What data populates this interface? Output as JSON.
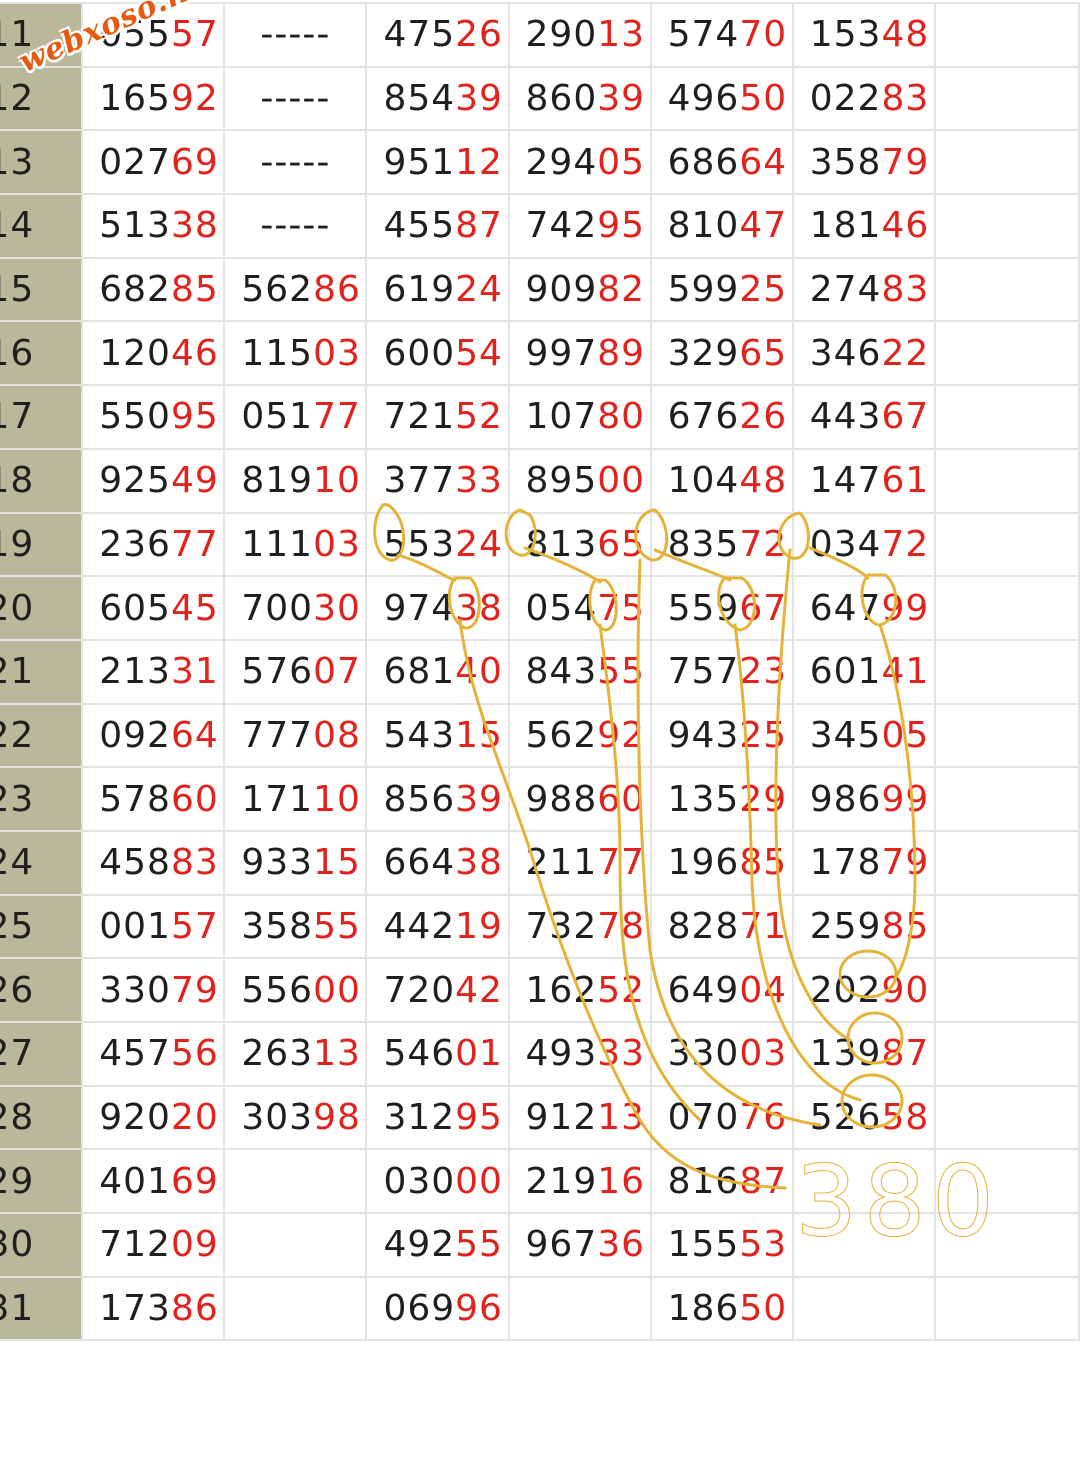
{
  "watermark": "webxoso.net",
  "annotation": "380",
  "colors": {
    "day_column_bg": "#b9b89a",
    "head_digits": "#1f1f1f",
    "tail_digits": "#e0231c",
    "annotation": "#e4b339",
    "watermark": "#e85a10"
  },
  "rows": [
    {
      "day": "11",
      "cells": [
        {
          "h": "055",
          "t": "57"
        },
        {
          "dash": "-----"
        },
        {
          "h": "475",
          "t": "26"
        },
        {
          "h": "290",
          "t": "13"
        },
        {
          "h": "574",
          "t": "70"
        },
        {
          "h": "153",
          "t": "48"
        }
      ]
    },
    {
      "day": "12",
      "cells": [
        {
          "h": "165",
          "t": "92"
        },
        {
          "dash": "-----"
        },
        {
          "h": "854",
          "t": "39"
        },
        {
          "h": "860",
          "t": "39"
        },
        {
          "h": "496",
          "t": "50"
        },
        {
          "h": "022",
          "t": "83"
        }
      ]
    },
    {
      "day": "13",
      "cells": [
        {
          "h": "027",
          "t": "69"
        },
        {
          "dash": "-----"
        },
        {
          "h": "951",
          "t": "12"
        },
        {
          "h": "294",
          "t": "05"
        },
        {
          "h": "686",
          "t": "64"
        },
        {
          "h": "358",
          "t": "79"
        }
      ]
    },
    {
      "day": "14",
      "cells": [
        {
          "h": "513",
          "t": "38"
        },
        {
          "dash": "-----"
        },
        {
          "h": "455",
          "t": "87"
        },
        {
          "h": "742",
          "t": "95"
        },
        {
          "h": "810",
          "t": "47"
        },
        {
          "h": "181",
          "t": "46"
        }
      ]
    },
    {
      "day": "15",
      "cells": [
        {
          "h": "682",
          "t": "85"
        },
        {
          "h": "562",
          "t": "86"
        },
        {
          "h": "619",
          "t": "24"
        },
        {
          "h": "909",
          "t": "82"
        },
        {
          "h": "599",
          "t": "25"
        },
        {
          "h": "274",
          "t": "83"
        }
      ]
    },
    {
      "day": "16",
      "cells": [
        {
          "h": "120",
          "t": "46"
        },
        {
          "h": "115",
          "t": "03"
        },
        {
          "h": "600",
          "t": "54"
        },
        {
          "h": "997",
          "t": "89"
        },
        {
          "h": "329",
          "t": "65"
        },
        {
          "h": "346",
          "t": "22"
        }
      ]
    },
    {
      "day": "17",
      "cells": [
        {
          "h": "550",
          "t": "95"
        },
        {
          "h": "051",
          "t": "77"
        },
        {
          "h": "721",
          "t": "52"
        },
        {
          "h": "107",
          "t": "80"
        },
        {
          "h": "676",
          "t": "26"
        },
        {
          "h": "443",
          "t": "67"
        }
      ]
    },
    {
      "day": "18",
      "cells": [
        {
          "h": "925",
          "t": "49"
        },
        {
          "h": "819",
          "t": "10"
        },
        {
          "h": "377",
          "t": "33"
        },
        {
          "h": "895",
          "t": "00"
        },
        {
          "h": "104",
          "t": "48"
        },
        {
          "h": "147",
          "t": "61"
        }
      ]
    },
    {
      "day": "19",
      "cells": [
        {
          "h": "236",
          "t": "77"
        },
        {
          "h": "111",
          "t": "03"
        },
        {
          "h": "553",
          "t": "24"
        },
        {
          "h": "813",
          "t": "65"
        },
        {
          "h": "835",
          "t": "72"
        },
        {
          "h": "034",
          "t": "72"
        }
      ]
    },
    {
      "day": "20",
      "cells": [
        {
          "h": "605",
          "t": "45"
        },
        {
          "h": "700",
          "t": "30"
        },
        {
          "h": "974",
          "t": "38"
        },
        {
          "h": "054",
          "t": "75"
        },
        {
          "h": "559",
          "t": "67"
        },
        {
          "h": "647",
          "t": "99"
        }
      ]
    },
    {
      "day": "21",
      "cells": [
        {
          "h": "213",
          "t": "31"
        },
        {
          "h": "576",
          "t": "07"
        },
        {
          "h": "681",
          "t": "40"
        },
        {
          "h": "843",
          "t": "55"
        },
        {
          "h": "757",
          "t": "23"
        },
        {
          "h": "601",
          "t": "41"
        }
      ]
    },
    {
      "day": "22",
      "cells": [
        {
          "h": "092",
          "t": "64"
        },
        {
          "h": "777",
          "t": "08"
        },
        {
          "h": "543",
          "t": "15"
        },
        {
          "h": "562",
          "t": "92"
        },
        {
          "h": "943",
          "t": "25"
        },
        {
          "h": "345",
          "t": "05"
        }
      ]
    },
    {
      "day": "23",
      "cells": [
        {
          "h": "578",
          "t": "60"
        },
        {
          "h": "171",
          "t": "10"
        },
        {
          "h": "856",
          "t": "39"
        },
        {
          "h": "988",
          "t": "60"
        },
        {
          "h": "135",
          "t": "29"
        },
        {
          "h": "986",
          "t": "99"
        }
      ]
    },
    {
      "day": "24",
      "cells": [
        {
          "h": "458",
          "t": "83"
        },
        {
          "h": "933",
          "t": "15"
        },
        {
          "h": "664",
          "t": "38"
        },
        {
          "h": "211",
          "t": "77"
        },
        {
          "h": "196",
          "t": "85"
        },
        {
          "h": "178",
          "t": "79"
        }
      ]
    },
    {
      "day": "25",
      "cells": [
        {
          "h": "001",
          "t": "57"
        },
        {
          "h": "358",
          "t": "55"
        },
        {
          "h": "442",
          "t": "19"
        },
        {
          "h": "732",
          "t": "78"
        },
        {
          "h": "828",
          "t": "71"
        },
        {
          "h": "259",
          "t": "85"
        }
      ]
    },
    {
      "day": "26",
      "cells": [
        {
          "h": "330",
          "t": "79"
        },
        {
          "h": "556",
          "t": "00"
        },
        {
          "h": "720",
          "t": "42"
        },
        {
          "h": "162",
          "t": "52"
        },
        {
          "h": "649",
          "t": "04"
        },
        {
          "h": "202",
          "t": "90"
        }
      ]
    },
    {
      "day": "27",
      "cells": [
        {
          "h": "457",
          "t": "56"
        },
        {
          "h": "263",
          "t": "13"
        },
        {
          "h": "546",
          "t": "01"
        },
        {
          "h": "493",
          "t": "33"
        },
        {
          "h": "330",
          "t": "03"
        },
        {
          "h": "139",
          "t": "87"
        }
      ]
    },
    {
      "day": "28",
      "cells": [
        {
          "h": "920",
          "t": "20"
        },
        {
          "h": "303",
          "t": "98"
        },
        {
          "h": "312",
          "t": "95"
        },
        {
          "h": "912",
          "t": "13"
        },
        {
          "h": "070",
          "t": "76"
        },
        {
          "h": "526",
          "t": "58"
        }
      ]
    },
    {
      "day": "29",
      "cells": [
        {
          "h": "401",
          "t": "69"
        },
        null,
        {
          "h": "030",
          "t": "00"
        },
        {
          "h": "219",
          "t": "16"
        },
        {
          "h": "816",
          "t": "87"
        },
        null
      ]
    },
    {
      "day": "30",
      "cells": [
        {
          "h": "712",
          "t": "09"
        },
        null,
        {
          "h": "492",
          "t": "55"
        },
        {
          "h": "967",
          "t": "36"
        },
        {
          "h": "155",
          "t": "53"
        },
        null
      ]
    },
    {
      "day": "31",
      "cells": [
        {
          "h": "173",
          "t": "86"
        },
        null,
        {
          "h": "069",
          "t": "96"
        },
        null,
        {
          "h": "186",
          "t": "50"
        },
        null
      ]
    }
  ]
}
